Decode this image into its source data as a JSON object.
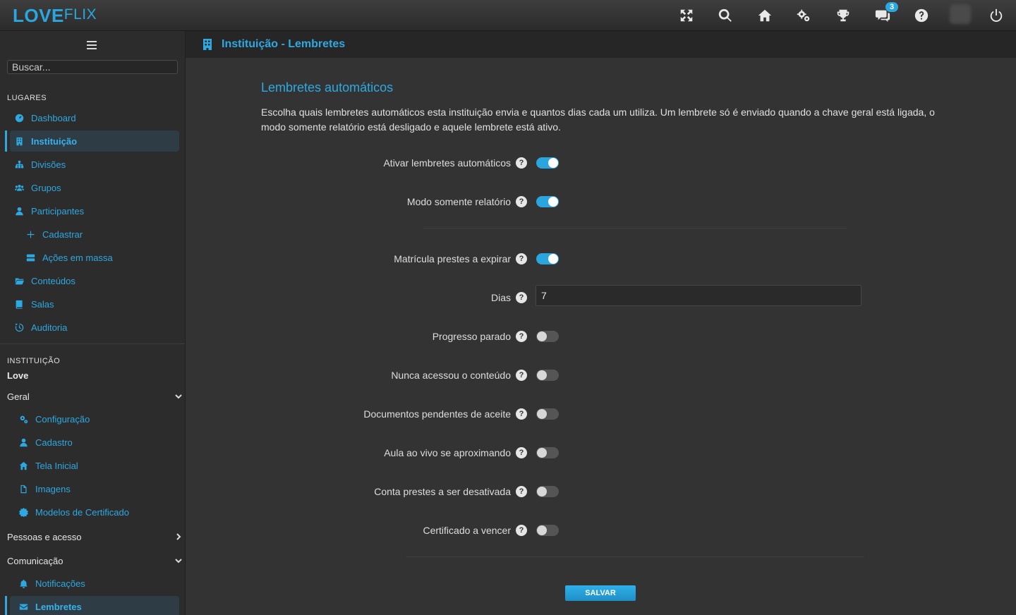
{
  "app": {
    "logo_love": "LOVE",
    "logo_flix": "FLIX"
  },
  "topbar": {
    "icons": [
      "fullscreen-icon",
      "search-icon",
      "home-icon",
      "gears-icon",
      "trophy-icon",
      "chat-icon",
      "help-icon",
      "power-icon"
    ],
    "chat_badge": "3"
  },
  "sidebar": {
    "search_placeholder": "Buscar...",
    "places_label": "LUGARES",
    "places": [
      {
        "label": "Dashboard",
        "icon": "dashboard-icon"
      },
      {
        "label": "Instituição",
        "icon": "building-icon"
      },
      {
        "label": "Divisões",
        "icon": "sitemap-icon"
      },
      {
        "label": "Grupos",
        "icon": "users-icon"
      },
      {
        "label": "Participantes",
        "icon": "user-icon"
      },
      {
        "label": "Cadastrar",
        "icon": "plus-icon"
      },
      {
        "label": "Ações em massa",
        "icon": "server-icon"
      },
      {
        "label": "Conteúdos",
        "icon": "folder-icon"
      },
      {
        "label": "Salas",
        "icon": "book-icon"
      },
      {
        "label": "Auditoria",
        "icon": "history-icon"
      }
    ],
    "institution_label": "INSTITUIÇÃO",
    "institution_name": "Love",
    "groups": {
      "geral": "Geral",
      "pessoas": "Pessoas e acesso",
      "comunicacao": "Comunicação"
    },
    "geral_items": [
      {
        "label": "Configuração",
        "icon": "gears-icon"
      },
      {
        "label": "Cadastro",
        "icon": "user-icon"
      },
      {
        "label": "Tela Inicial",
        "icon": "home-icon"
      },
      {
        "label": "Imagens",
        "icon": "file-icon"
      },
      {
        "label": "Modelos de Certificado",
        "icon": "certificate-icon"
      }
    ],
    "comunicacao_items": [
      {
        "label": "Notificações",
        "icon": "bell-icon"
      },
      {
        "label": "Lembretes",
        "icon": "envelope-icon"
      }
    ]
  },
  "header": {
    "title": "Instituição - Lembretes"
  },
  "main": {
    "title": "Lembretes automáticos",
    "description": "Escolha quais lembretes automáticos esta instituição envia e quantos dias cada um utiliza. Um lembrete só é enviado quando a chave geral está ligada, o modo somente relatório está desligado e aquele lembrete está ativo.",
    "help_glyph": "?",
    "settings": [
      {
        "label": "Ativar lembretes automáticos",
        "on": true
      },
      {
        "label": "Modo somente relatório",
        "on": true
      },
      {
        "label": "Matrícula prestes a expirar",
        "on": true
      },
      {
        "label": "Progresso parado",
        "on": false
      },
      {
        "label": "Nunca acessou o conteúdo",
        "on": false
      },
      {
        "label": "Documentos pendentes de aceite",
        "on": false
      },
      {
        "label": "Aula ao vivo se aproximando",
        "on": false
      },
      {
        "label": "Conta prestes a ser desativada",
        "on": false
      },
      {
        "label": "Certificado a vencer",
        "on": false
      }
    ],
    "days_label": "Dias",
    "days_value": "7",
    "save_label": "SALVAR"
  },
  "colors": {
    "accent": "#2ea8e0",
    "background": "#333333",
    "sidebar": "#2c2c2c"
  }
}
